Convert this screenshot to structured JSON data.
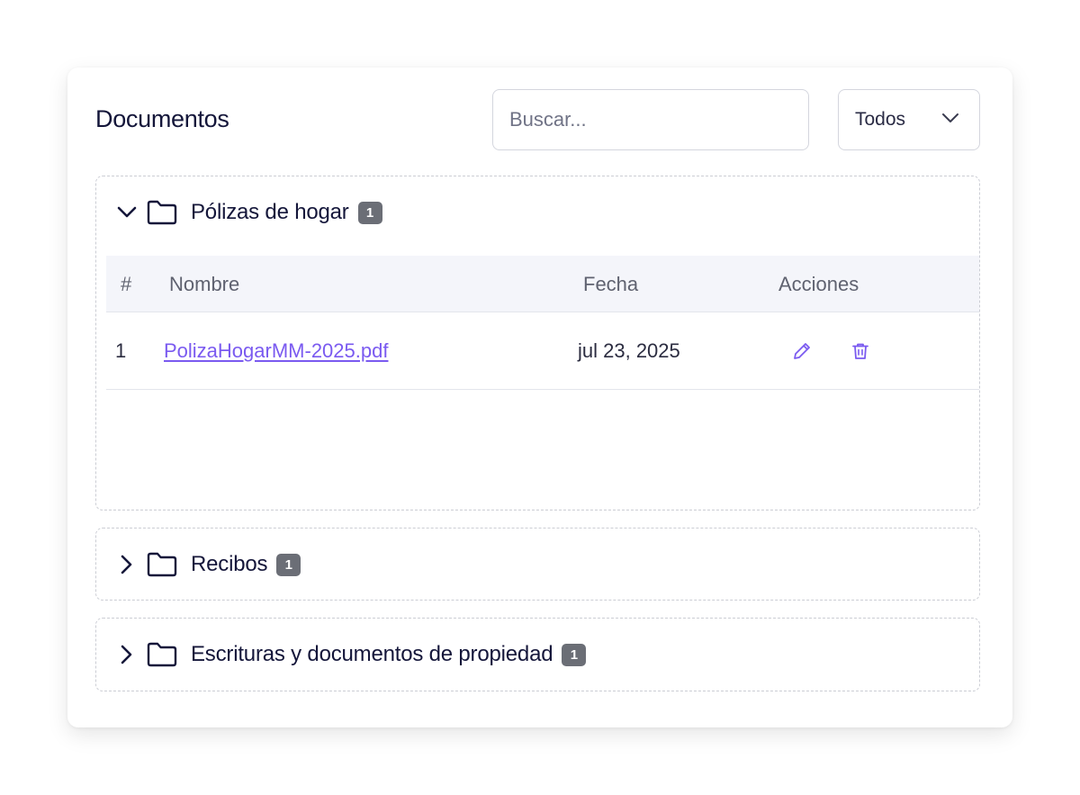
{
  "header": {
    "title": "Documentos",
    "search_placeholder": "Buscar...",
    "filter_selected": "Todos"
  },
  "colors": {
    "accent": "#7a5af0",
    "badge": "#6b6e76",
    "table_header_bg": "#f4f5fa"
  },
  "sections": [
    {
      "title": "Pólizas de hogar",
      "count": "1",
      "expanded": true,
      "icon": "folder-icon",
      "table": {
        "columns": [
          "#",
          "Nombre",
          "Fecha",
          "Acciones"
        ],
        "rows": [
          {
            "index": "1",
            "name": "PolizaHogarMM-2025.pdf",
            "date": "jul 23, 2025",
            "actions": [
              "edit-icon",
              "trash-icon"
            ]
          }
        ]
      }
    },
    {
      "title": "Recibos",
      "count": "1",
      "expanded": false,
      "icon": "folder-icon"
    },
    {
      "title": "Escrituras y documentos de propiedad",
      "count": "1",
      "expanded": false,
      "icon": "folder-icon"
    }
  ]
}
